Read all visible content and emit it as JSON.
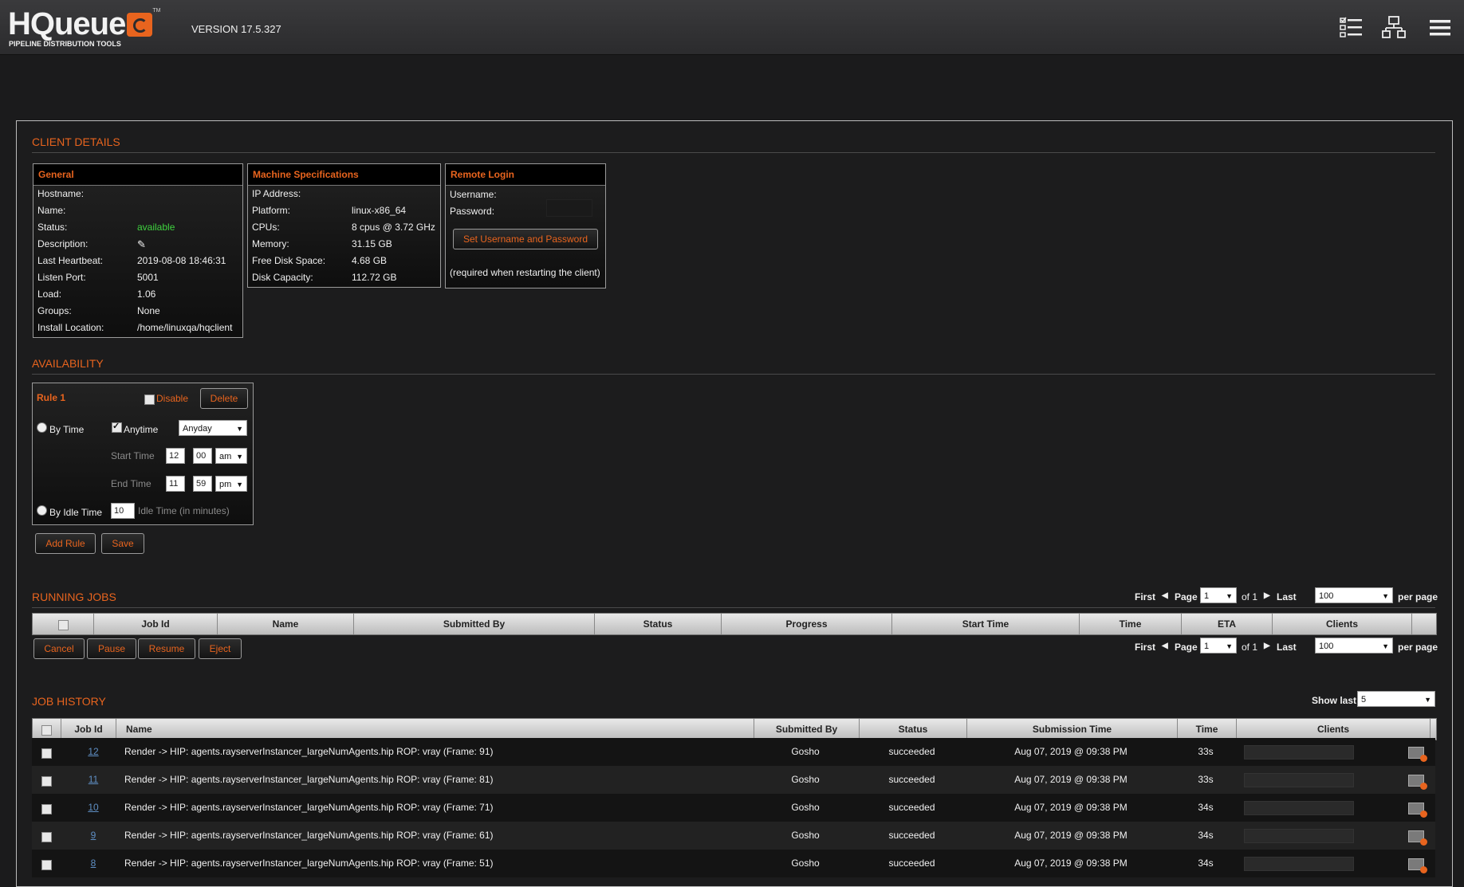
{
  "header": {
    "logo_text": "HQueue",
    "logo_tm": "TM",
    "logo_subtitle": "PIPELINE DISTRIBUTION TOOLS",
    "version": "VERSION 17.5.327",
    "icons": [
      "job-list-icon",
      "network-icon",
      "menu-icon"
    ]
  },
  "client_details": {
    "title": "CLIENT DETAILS",
    "general": {
      "title": "General",
      "rows": [
        {
          "label": "Hostname:",
          "value": ""
        },
        {
          "label": "Name:",
          "value": ""
        },
        {
          "label": "Status:",
          "value": "available"
        },
        {
          "label": "Description:",
          "value": ""
        },
        {
          "label": "Last Heartbeat:",
          "value": "2019-08-08 18:46:31"
        },
        {
          "label": "Listen Port:",
          "value": "5001"
        },
        {
          "label": "Load:",
          "value": "1.06"
        },
        {
          "label": "Groups:",
          "value": "None"
        },
        {
          "label": "Install Location:",
          "value": "/home/linuxqa/hqclient"
        }
      ]
    },
    "machine": {
      "title": "Machine Specifications",
      "rows": [
        {
          "label": "IP Address:",
          "value": ""
        },
        {
          "label": "Platform:",
          "value": "linux-x86_64"
        },
        {
          "label": "CPUs:",
          "value": "8 cpus @ 3.72 GHz"
        },
        {
          "label": "Memory:",
          "value": "31.15 GB"
        },
        {
          "label": "Free Disk Space:",
          "value": "4.68 GB"
        },
        {
          "label": "Disk Capacity:",
          "value": "112.72 GB"
        }
      ]
    },
    "remote": {
      "title": "Remote Login",
      "username_label": "Username:",
      "password_label": "Password:",
      "set_button": "Set Username and Password",
      "note": "(required when restarting the client)"
    }
  },
  "availability": {
    "title": "AVAILABILITY",
    "rule_title": "Rule 1",
    "disable_label": "Disable",
    "delete_label": "Delete",
    "by_time_label": "By Time",
    "anytime_label": "Anytime",
    "day_select": "Anyday",
    "start_time_label": "Start Time",
    "start_hour": "12",
    "start_min": "00",
    "start_ampm": "am",
    "end_time_label": "End Time",
    "end_hour": "11",
    "end_min": "59",
    "end_ampm": "pm",
    "by_idle_label": "By Idle Time",
    "idle_value": "10",
    "idle_label": "Idle Time (in minutes)",
    "add_rule": "Add Rule",
    "save": "Save"
  },
  "running_jobs": {
    "title": "RUNNING JOBS",
    "pager": {
      "first": "First",
      "page": "Page",
      "page_value": "1",
      "of": "of 1",
      "last": "Last",
      "per_page_value": "100",
      "per_page": "per page"
    },
    "columns": [
      "Job Id",
      "Name",
      "Submitted By",
      "Status",
      "Progress",
      "Start Time",
      "Time",
      "ETA",
      "Clients"
    ],
    "buttons": [
      "Cancel",
      "Pause",
      "Resume",
      "Eject"
    ]
  },
  "job_history": {
    "title": "JOB HISTORY",
    "show_last_label": "Show last",
    "show_last_value": "5",
    "columns": [
      "Job Id",
      "Name",
      "Submitted By",
      "Status",
      "Submission Time",
      "Time",
      "Clients"
    ],
    "rows": [
      {
        "id": "12",
        "name": "Render -> HIP: agents.rayserverInstancer_largeNumAgents.hip ROP: vray (Frame: 91)",
        "by": "Gosho",
        "status": "succeeded",
        "time_sub": "Aug 07, 2019 @ 09:38 PM",
        "time": "33s"
      },
      {
        "id": "11",
        "name": "Render -> HIP: agents.rayserverInstancer_largeNumAgents.hip ROP: vray (Frame: 81)",
        "by": "Gosho",
        "status": "succeeded",
        "time_sub": "Aug 07, 2019 @ 09:38 PM",
        "time": "33s"
      },
      {
        "id": "10",
        "name": "Render -> HIP: agents.rayserverInstancer_largeNumAgents.hip ROP: vray (Frame: 71)",
        "by": "Gosho",
        "status": "succeeded",
        "time_sub": "Aug 07, 2019 @ 09:38 PM",
        "time": "34s"
      },
      {
        "id": "9",
        "name": "Render -> HIP: agents.rayserverInstancer_largeNumAgents.hip ROP: vray (Frame: 61)",
        "by": "Gosho",
        "status": "succeeded",
        "time_sub": "Aug 07, 2019 @ 09:38 PM",
        "time": "34s"
      },
      {
        "id": "8",
        "name": "Render -> HIP: agents.rayserverInstancer_largeNumAgents.hip ROP: vray (Frame: 51)",
        "by": "Gosho",
        "status": "succeeded",
        "time_sub": "Aug 07, 2019 @ 09:38 PM",
        "time": "34s"
      }
    ]
  },
  "colors": {
    "accent": "#e8641e",
    "success": "#3fd23f",
    "link": "#5f8fc4",
    "background": "#1b1b1c"
  }
}
